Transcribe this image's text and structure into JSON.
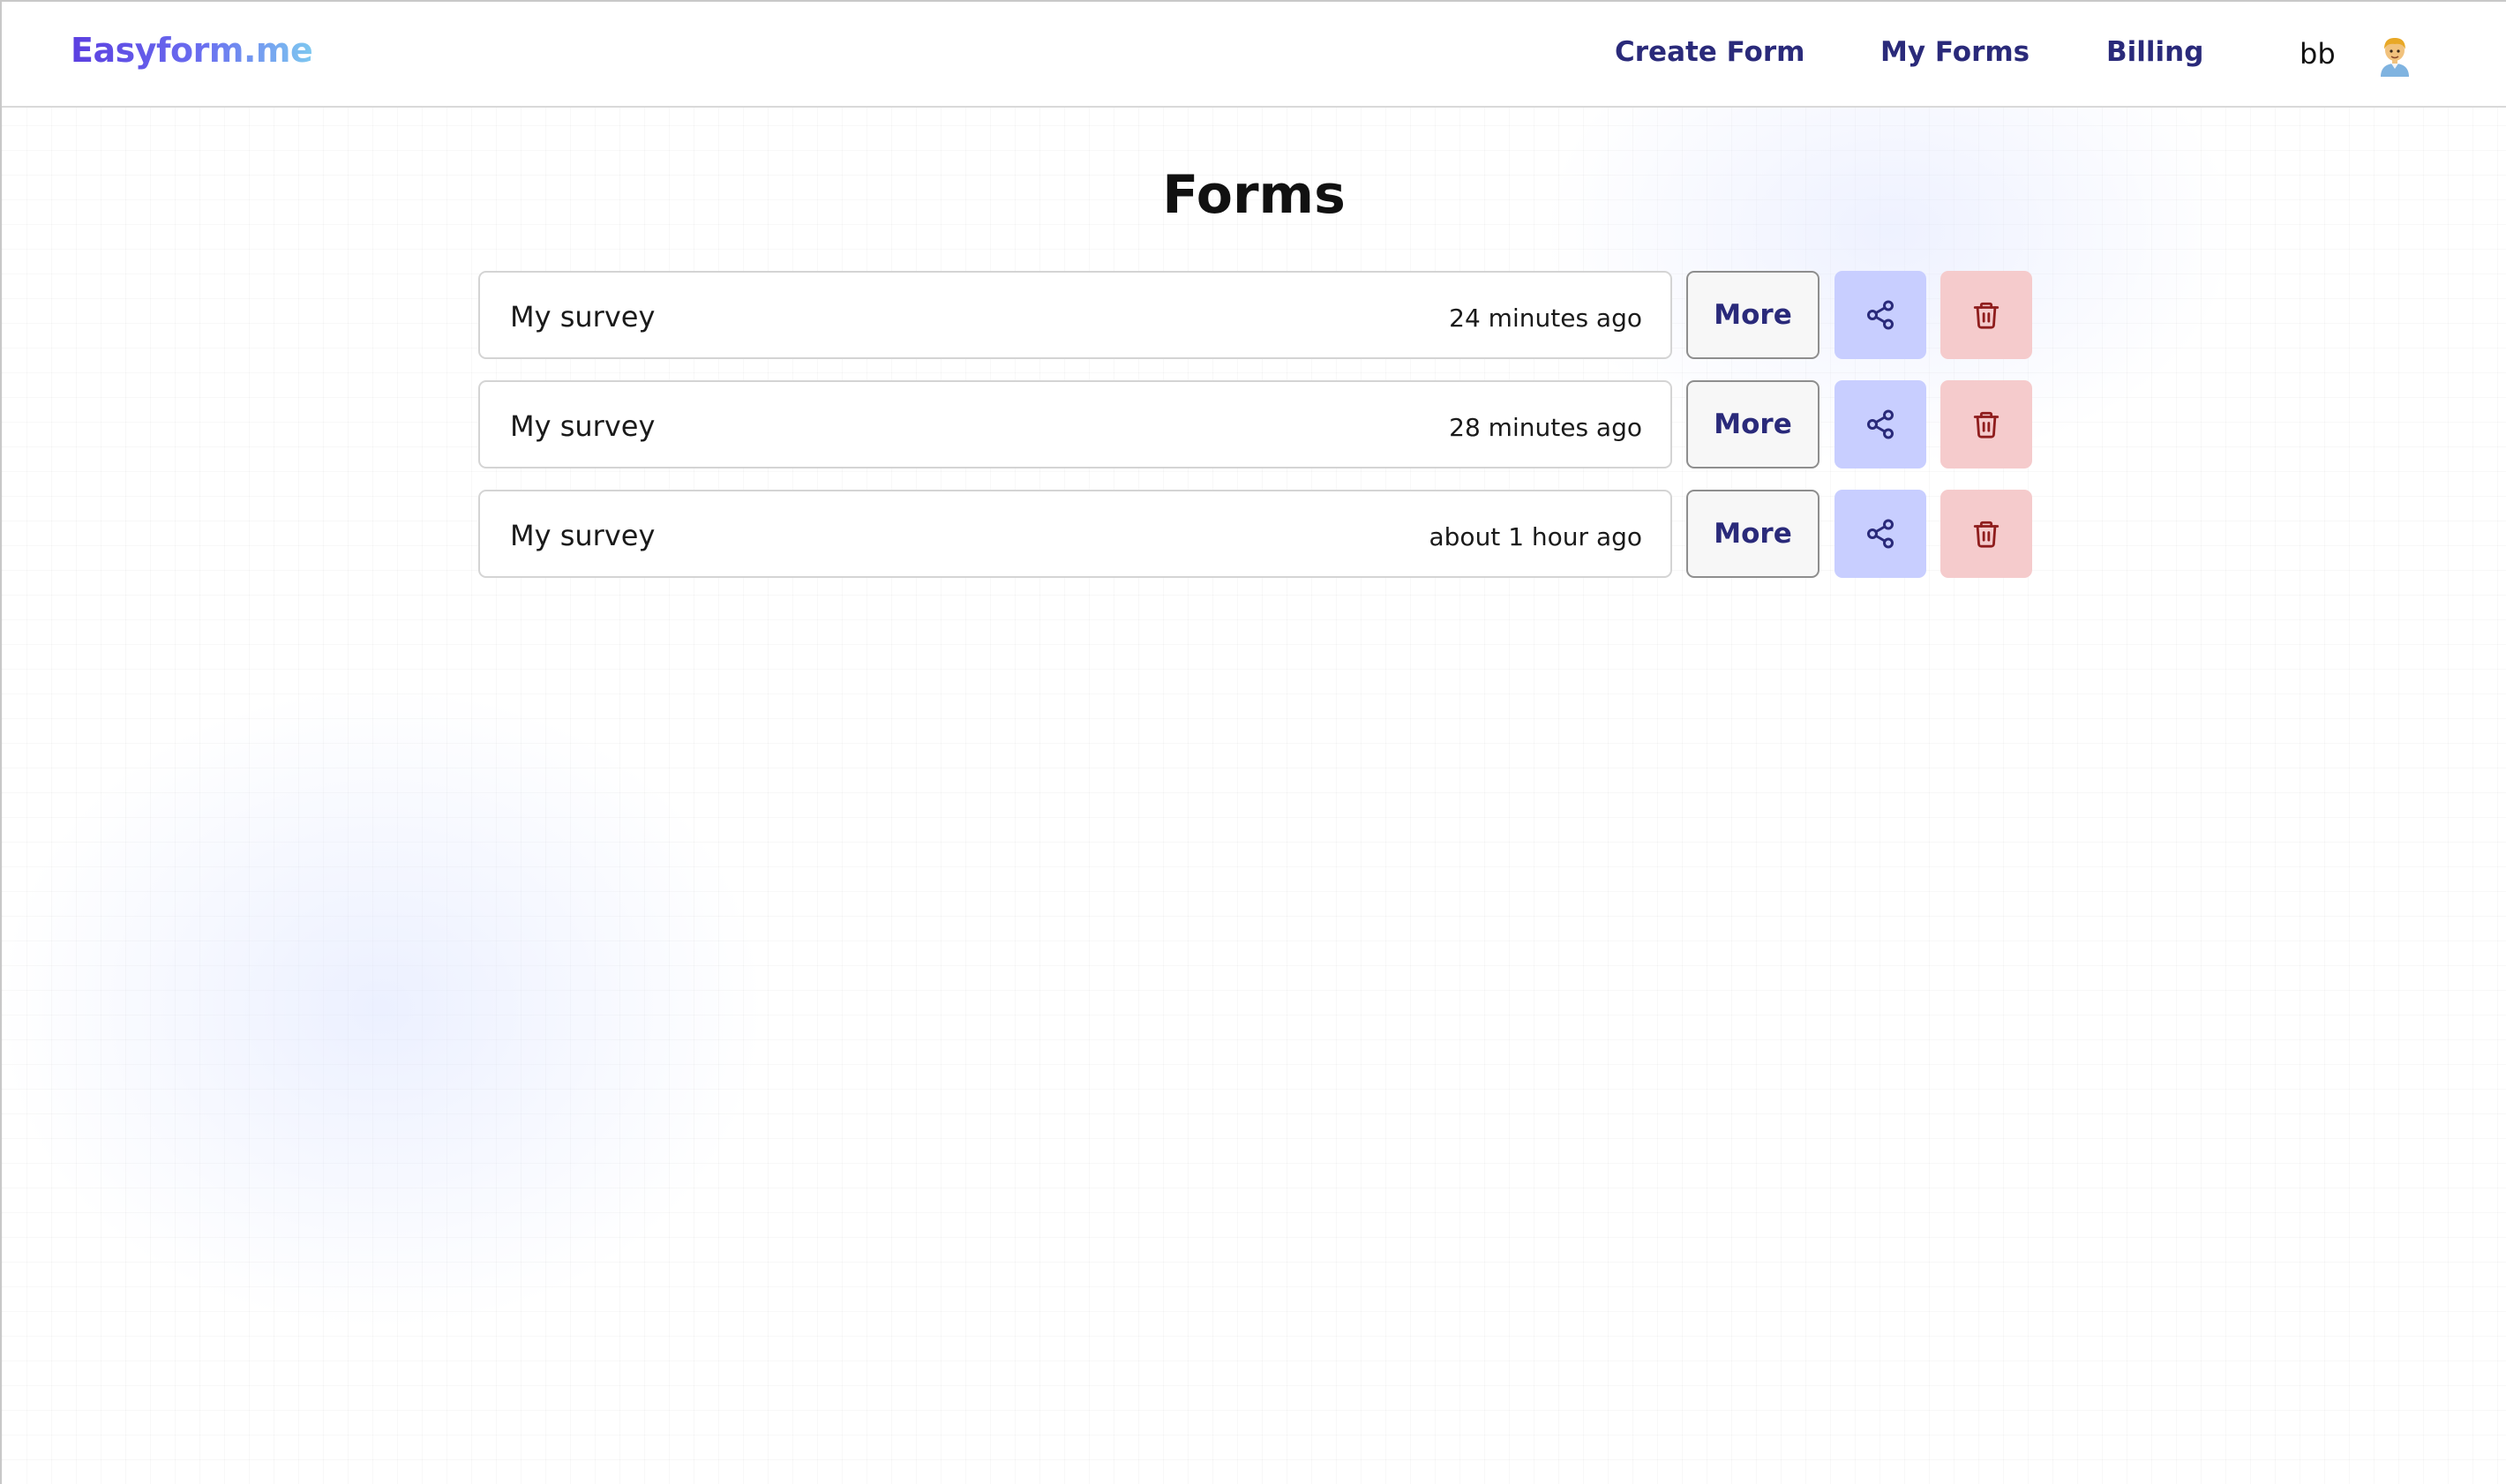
{
  "navbar": {
    "logo": "Easyform.me",
    "links": [
      {
        "label": "Create Form"
      },
      {
        "label": "My Forms"
      },
      {
        "label": "Billing"
      }
    ],
    "user_name": "bb",
    "avatar_icon": "person-avatar-icon"
  },
  "main": {
    "title": "Forms",
    "forms": [
      {
        "name": "My survey",
        "time": "24 minutes ago",
        "more_label": "More"
      },
      {
        "name": "My survey",
        "time": "28 minutes ago",
        "more_label": "More"
      },
      {
        "name": "My survey",
        "time": "about 1 hour ago",
        "more_label": "More"
      }
    ],
    "icons": {
      "share": "share-icon",
      "delete": "trash-icon"
    }
  },
  "colors": {
    "nav_text": "#2a2a7a",
    "share_bg": "#c8ceff",
    "share_icon": "#2a2a7a",
    "delete_bg": "#f5cbcc",
    "delete_icon": "#8f1d1d"
  }
}
